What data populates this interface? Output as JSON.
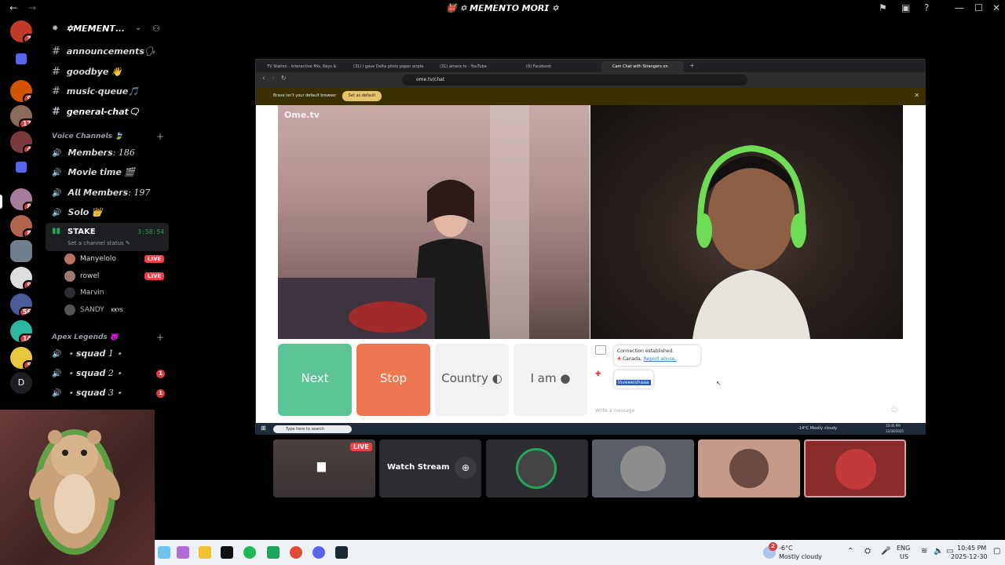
{
  "window": {
    "title": "👹 ✡ 𝙈𝙀𝙈𝙀𝙉𝙏𝙊 𝙈𝙊𝙍𝙄 ✡"
  },
  "servers": {
    "badges": [
      "3",
      "9",
      "17",
      "4",
      "8",
      "8",
      "9",
      "56",
      "14",
      "5"
    ],
    "letter": "D"
  },
  "guild": {
    "name": "✡𝙈𝙀𝙈𝙀𝙉𝙏..."
  },
  "channels": {
    "text": [
      {
        "name": "𝙖𝙣𝙣𝙤𝙪𝙣𝙘𝙚𝙢𝙚𝙣𝙩𝙨🗣"
      },
      {
        "name": "𝙜𝙤𝙤𝙙𝙗𝙮𝙚 👋"
      },
      {
        "name": "𝙢𝙪𝙨𝙞𝙘-𝙦𝙪𝙚𝙪𝙚🎵"
      },
      {
        "name": "𝙜𝙚𝙣𝙚𝙧𝙖𝙡-𝙘𝙝𝙖𝙩🗨"
      }
    ],
    "voice_category": "𝙑𝙤𝙞𝙘𝙚 𝘾𝙝𝙖𝙣𝙣𝙚𝙡𝙨 🍃",
    "voice": [
      {
        "name": "𝙈𝙚𝙢𝙗𝙚𝙧𝙨: 186"
      },
      {
        "name": "𝙈𝙤𝙫𝙞𝙚 𝙩𝙞𝙢𝙚 🎬"
      },
      {
        "name": "𝘼𝙡𝙡 𝙈𝙚𝙢𝙗𝙚𝙧𝙨: 197"
      },
      {
        "name": "𝙎𝙤𝙡𝙤 👑"
      }
    ],
    "stake": {
      "name": "STAKE",
      "time": "3:58:54",
      "status": "Set a channel status ✎"
    },
    "stake_users": [
      {
        "name": "Manyelolo",
        "live": "LIVE"
      },
      {
        "name": "rowel",
        "live": "LIVE"
      },
      {
        "name": "Marvin"
      },
      {
        "name": "SANDY",
        "tag": "KKYS"
      }
    ],
    "apex_category": "𝘼𝙥𝙚𝙭 𝙇𝙚𝙜𝙚𝙣𝙙𝙨 😈",
    "apex": [
      {
        "name": "⋆ 𝙨𝙦𝙪𝙖𝙙 1 ⋆",
        "badge": ""
      },
      {
        "name": "⋆ 𝙨𝙦𝙪𝙖𝙙 2 ⋆",
        "badge": "1"
      },
      {
        "name": "⋆ 𝙨𝙦𝙪𝙖𝙙 3 ⋆",
        "badge": "1"
      }
    ]
  },
  "browser": {
    "tabs": [
      "TV Station - Interactive Mix, Keys &",
      "(31) I gave Delta pilots paper airpla",
      "(31) amara tv - YouTube",
      "(9) Facebook",
      "Cam Chat with Strangers on"
    ],
    "url": "ome.tv/chat",
    "notice": "Brave isn't your default browser",
    "notice_btn": "Set as default",
    "logo": "Ome.tv",
    "next": "Next",
    "stop": "Stop",
    "country": "Country",
    "iam": "I am",
    "sys_msg": "Connection established.",
    "sys_country": "Canada.",
    "sys_report": "Report abuse.",
    "user_msg": "loveeeishaaa",
    "write_placeholder": "Write a message",
    "inner_search": "Type here to search",
    "inner_weather": "-14°C  Mostly cloudy",
    "inner_time": "10:45 PM",
    "inner_date": "12/30/2025"
  },
  "stream": {
    "live": "LIVE",
    "watch": "Watch Stream"
  },
  "taskbar": {
    "weather_temp": "-6°C",
    "weather_desc": "Mostly cloudy",
    "weather_badge": "2",
    "lang": "ENG",
    "region": "US",
    "time": "10:45 PM",
    "date": "2025-12-30"
  },
  "colors": {
    "next": "#5cc596",
    "stop": "#ee7650",
    "discord_red": "#ed4245",
    "stake_green": "#23a55a"
  }
}
